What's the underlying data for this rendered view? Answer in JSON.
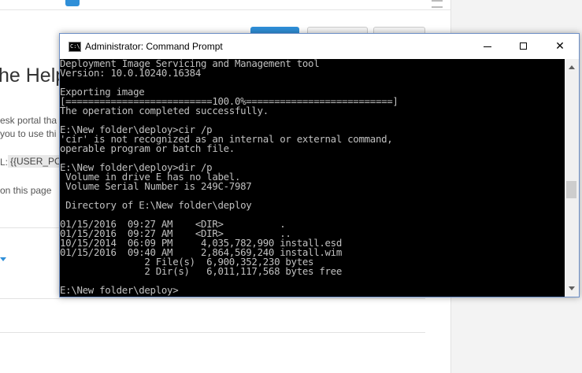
{
  "background_page": {
    "title": "he Help",
    "line1": "esk portal tha",
    "line2": "you to use thi",
    "url_label": "L:",
    "url_code": "{{USER_PC",
    "line3": "on this page"
  },
  "window": {
    "title": "Administrator: Command Prompt",
    "icon_text": "C:\\",
    "close_symbol": "✕"
  },
  "console_lines": [
    "Deployment Image Servicing and Management tool",
    "Version: 10.0.10240.16384",
    "",
    "Exporting image",
    "[==========================100.0%==========================]",
    "The operation completed successfully.",
    "",
    "E:\\New folder\\deploy>cir /p",
    "'cir' is not recognized as an internal or external command,",
    "operable program or batch file.",
    "",
    "E:\\New folder\\deploy>dir /p",
    " Volume in drive E has no label.",
    " Volume Serial Number is 249C-7987",
    "",
    " Directory of E:\\New folder\\deploy",
    "",
    "01/15/2016  09:27 AM    <DIR>          .",
    "01/15/2016  09:27 AM    <DIR>          ..",
    "10/15/2014  06:09 PM     4,035,782,990 install.esd",
    "01/15/2016  09:40 AM     2,864,569,240 install.wim",
    "               2 File(s)  6,900,352,230 bytes",
    "               2 Dir(s)   6,011,117,568 bytes free",
    "",
    "E:\\New folder\\deploy>"
  ]
}
